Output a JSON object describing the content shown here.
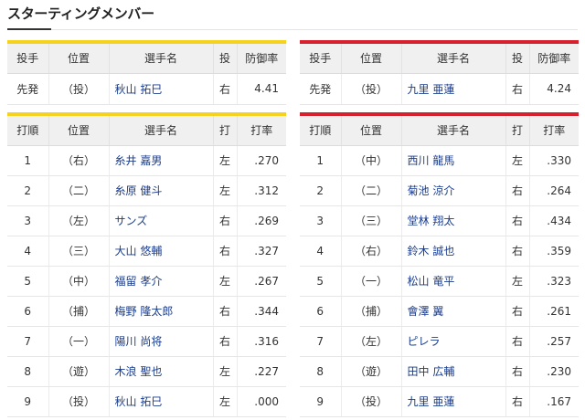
{
  "title": "スターティングメンバー",
  "colors": {
    "home_accent": "#f4d21f",
    "away_accent": "#d7202e",
    "link": "#1a3c8c"
  },
  "pitchers": {
    "headers": [
      "投手",
      "位置",
      "選手名",
      "投",
      "防御率"
    ],
    "left": {
      "role": "先発",
      "pos": "（投）",
      "name": "秋山 拓巳",
      "hand": "右",
      "era": "4.41"
    },
    "right": {
      "role": "先発",
      "pos": "（投）",
      "name": "九里 亜蓮",
      "hand": "右",
      "era": "4.24"
    }
  },
  "lineup": {
    "headers": [
      "打順",
      "位置",
      "選手名",
      "打",
      "打率"
    ],
    "left": [
      {
        "order": "1",
        "pos": "（右）",
        "name": "糸井 嘉男",
        "bat": "左",
        "avg": ".270"
      },
      {
        "order": "2",
        "pos": "（二）",
        "name": "糸原 健斗",
        "bat": "左",
        "avg": ".312"
      },
      {
        "order": "3",
        "pos": "（左）",
        "name": "サンズ",
        "bat": "右",
        "avg": ".269"
      },
      {
        "order": "4",
        "pos": "（三）",
        "name": "大山 悠輔",
        "bat": "右",
        "avg": ".327"
      },
      {
        "order": "5",
        "pos": "（中）",
        "name": "福留 孝介",
        "bat": "左",
        "avg": ".267"
      },
      {
        "order": "6",
        "pos": "（捕）",
        "name": "梅野 隆太郎",
        "bat": "右",
        "avg": ".344"
      },
      {
        "order": "7",
        "pos": "（一）",
        "name": "陽川 尚将",
        "bat": "右",
        "avg": ".316"
      },
      {
        "order": "8",
        "pos": "（遊）",
        "name": "木浪 聖也",
        "bat": "左",
        "avg": ".227"
      },
      {
        "order": "9",
        "pos": "（投）",
        "name": "秋山 拓巳",
        "bat": "左",
        "avg": ".000"
      }
    ],
    "right": [
      {
        "order": "1",
        "pos": "（中）",
        "name": "西川 龍馬",
        "bat": "左",
        "avg": ".330"
      },
      {
        "order": "2",
        "pos": "（二）",
        "name": "菊池 涼介",
        "bat": "右",
        "avg": ".264"
      },
      {
        "order": "3",
        "pos": "（三）",
        "name": "堂林 翔太",
        "bat": "右",
        "avg": ".434"
      },
      {
        "order": "4",
        "pos": "（右）",
        "name": "鈴木 誠也",
        "bat": "右",
        "avg": ".359"
      },
      {
        "order": "5",
        "pos": "（一）",
        "name": "松山 竜平",
        "bat": "左",
        "avg": ".323"
      },
      {
        "order": "6",
        "pos": "（捕）",
        "name": "會澤 翼",
        "bat": "右",
        "avg": ".261"
      },
      {
        "order": "7",
        "pos": "（左）",
        "name": "ピレラ",
        "bat": "右",
        "avg": ".257"
      },
      {
        "order": "8",
        "pos": "（遊）",
        "name": "田中 広輔",
        "bat": "右",
        "avg": ".230"
      },
      {
        "order": "9",
        "pos": "（投）",
        "name": "九里 亜蓮",
        "bat": "右",
        "avg": ".167"
      }
    ]
  }
}
